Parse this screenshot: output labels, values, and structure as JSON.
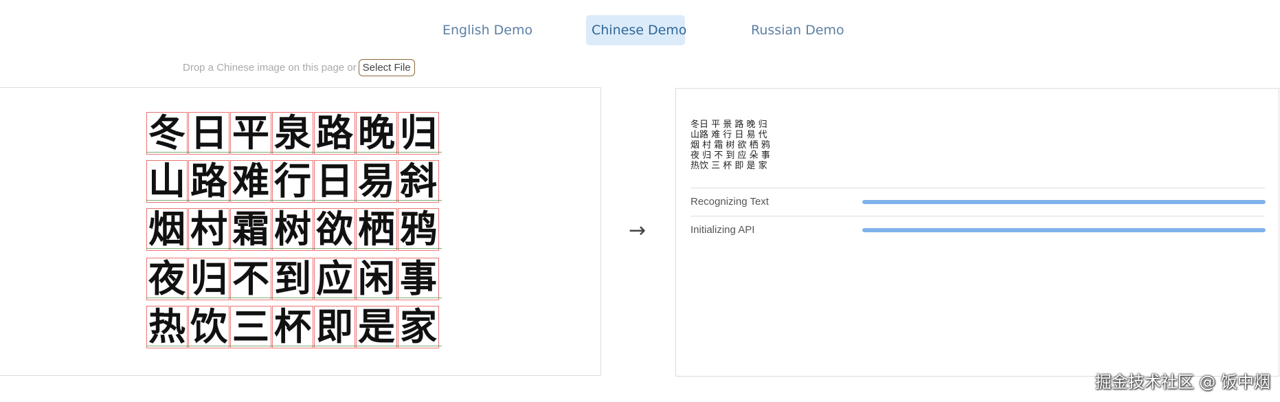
{
  "tabs": [
    {
      "label": "English Demo",
      "active": false
    },
    {
      "label": "Chinese Demo",
      "active": true
    },
    {
      "label": "Russian Demo",
      "active": false
    }
  ],
  "drop": {
    "text": "Drop a Chinese image on this page or",
    "button_label": "Select File"
  },
  "image_panel": {
    "lines": [
      [
        "冬",
        "日",
        "平",
        "泉",
        "路",
        "晚",
        "归"
      ],
      [
        "山",
        "路",
        "难",
        "行",
        "日",
        "易",
        "斜"
      ],
      [
        "烟",
        "村",
        "霜",
        "树",
        "欲",
        "栖",
        "鸦"
      ],
      [
        "夜",
        "归",
        "不",
        "到",
        "应",
        "闲",
        "事"
      ],
      [
        "热",
        "饮",
        "三",
        "杯",
        "即",
        "是",
        "家"
      ]
    ]
  },
  "arrow": "→",
  "result": {
    "text": "冬日 平 景 路 晚 归\n山路 难 行 日 易 代\n烟 村 霜 树 欲 栖 鸦\n夜 归 不 到 应 朵 事\n热饮 三 杯 即 是 家"
  },
  "status": [
    {
      "label": "Recognizing Text",
      "progress": 1.0
    },
    {
      "label": "Initializing API",
      "progress": 1.0
    }
  ],
  "colors": {
    "accent": "#7fb2ea",
    "active_tab_bg": "#dcebfa",
    "tab_text": "#5b7fa3"
  },
  "watermark": "掘金技术社区 @ 饭中烟"
}
